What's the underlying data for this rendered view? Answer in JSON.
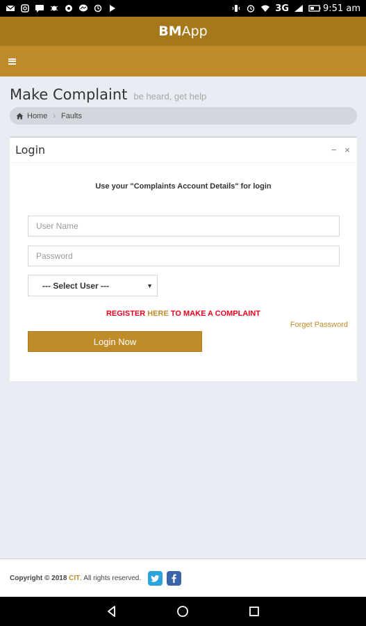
{
  "status_bar": {
    "network": "3G",
    "time": "9:51 am"
  },
  "app": {
    "title_bold": "BM",
    "title_rest": "App"
  },
  "page": {
    "title": "Make Complaint",
    "subtitle": "be heard, get help"
  },
  "breadcrumb": {
    "home": "Home",
    "current": "Faults"
  },
  "login_box": {
    "title": "Login",
    "minimize": "−",
    "close": "×",
    "message": "Use your \"Complaints Account Details\" for login",
    "username_placeholder": "User Name",
    "password_placeholder": "Password",
    "select_user": {
      "selected": "--- Select User ---"
    },
    "register": {
      "part1": "REGISTER ",
      "here": "HERE",
      "part2": " TO MAKE A COMPLAINT"
    },
    "forgot_password": "Forget Password",
    "login_button": "Login Now"
  },
  "footer": {
    "copyright_prefix": "Copyright © 2018 ",
    "brand": "CIT",
    "suffix": ". All rights reserved."
  },
  "colors": {
    "title_bar": "#a5781c",
    "menu_bar": "#c08c2a",
    "accent": "#c08c2a",
    "register_red": "#e8001c"
  },
  "icons": {
    "menu": "hamburger-icon",
    "home": "home-icon",
    "twitter": "twitter-icon",
    "facebook": "facebook-icon"
  }
}
